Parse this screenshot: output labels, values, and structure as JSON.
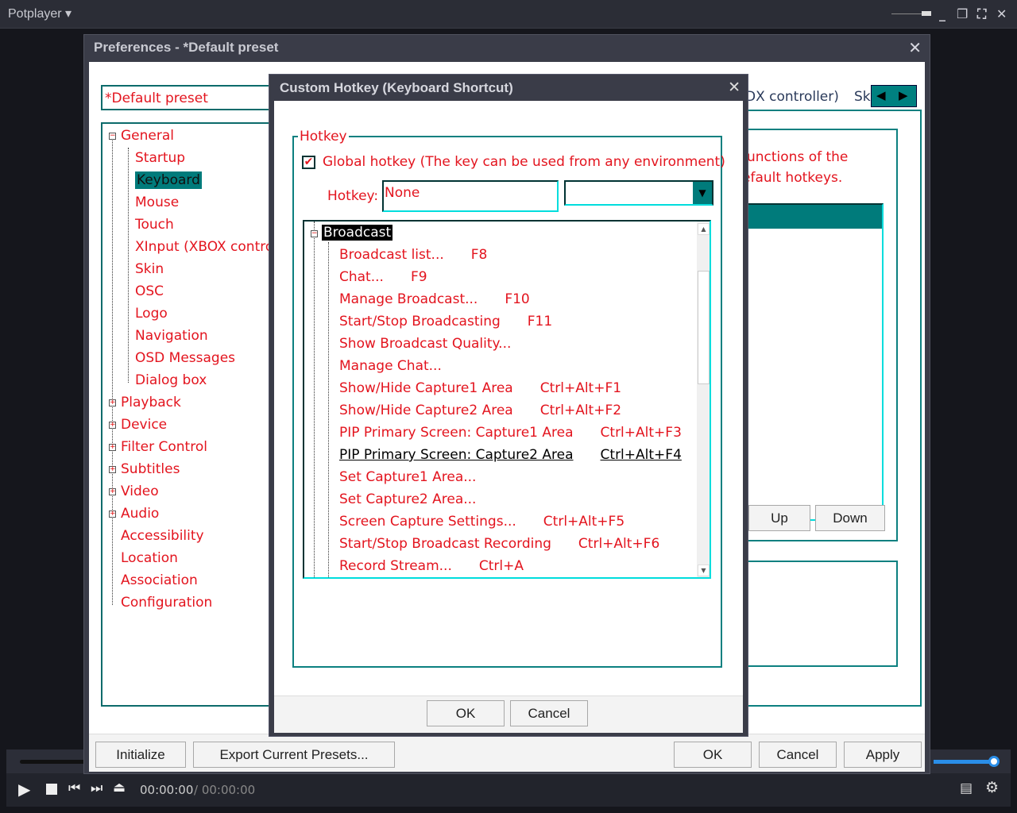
{
  "app": {
    "title": "Potplayer ▾"
  },
  "preferences": {
    "title": "Preferences - *Default preset",
    "preset": "*Default preset",
    "tab_partial": "DX controller)",
    "tab_partial2": "Ski",
    "desc_line1": "functions of the",
    "desc_line2": "efault hotkeys.",
    "up": "Up",
    "down": "Down",
    "tree": [
      {
        "label": "General",
        "level": 0,
        "expander": "−"
      },
      {
        "label": "Startup",
        "level": 1
      },
      {
        "label": "Keyboard",
        "level": 1,
        "selected": true
      },
      {
        "label": "Mouse",
        "level": 1
      },
      {
        "label": "Touch",
        "level": 1
      },
      {
        "label": "XInput (XBOX contro",
        "level": 1
      },
      {
        "label": "Skin",
        "level": 1
      },
      {
        "label": "OSC",
        "level": 1
      },
      {
        "label": "Logo",
        "level": 1
      },
      {
        "label": "Navigation",
        "level": 1
      },
      {
        "label": "OSD Messages",
        "level": 1
      },
      {
        "label": "Dialog box",
        "level": 1
      },
      {
        "label": "Playback",
        "level": 0,
        "expander": "+"
      },
      {
        "label": "Device",
        "level": 0,
        "expander": "+"
      },
      {
        "label": "Filter Control",
        "level": 0,
        "expander": "+"
      },
      {
        "label": "Subtitles",
        "level": 0,
        "expander": "+"
      },
      {
        "label": "Video",
        "level": 0,
        "expander": "+"
      },
      {
        "label": "Audio",
        "level": 0,
        "expander": "+"
      },
      {
        "label": "Accessibility",
        "level": 0
      },
      {
        "label": "Location",
        "level": 0
      },
      {
        "label": "Association",
        "level": 0
      },
      {
        "label": "Configuration",
        "level": 0
      }
    ],
    "buttons": {
      "initialize": "Initialize",
      "export": "Export Current Presets...",
      "ok": "OK",
      "cancel": "Cancel",
      "apply": "Apply"
    }
  },
  "hotkey_dialog": {
    "title": "Custom Hotkey (Keyboard Shortcut)",
    "group": "Hotkey",
    "global_label": "Global hotkey (The key can be used from any environment)",
    "global_checked": true,
    "hotkey_label": "Hotkey:",
    "hotkey_value": "None",
    "dropdown_value": "",
    "root": "Broadcast",
    "items": [
      {
        "label": "Broadcast list...",
        "key": "F8"
      },
      {
        "label": "Chat...",
        "key": "F9"
      },
      {
        "label": "Manage Broadcast...",
        "key": "F10"
      },
      {
        "label": "Start/Stop Broadcasting",
        "key": "F11"
      },
      {
        "label": "Show Broadcast Quality...",
        "key": ""
      },
      {
        "label": "Manage Chat...",
        "key": ""
      },
      {
        "label": "Show/Hide Capture1 Area",
        "key": "Ctrl+Alt+F1"
      },
      {
        "label": "Show/Hide Capture2 Area",
        "key": "Ctrl+Alt+F2"
      },
      {
        "label": "PIP Primary Screen:  Capture1 Area",
        "key": "Ctrl+Alt+F3"
      },
      {
        "label": "PIP Primary Screen:  Capture2 Area",
        "key": "Ctrl+Alt+F4",
        "hover": true
      },
      {
        "label": "Set Capture1 Area...",
        "key": ""
      },
      {
        "label": "Set Capture2 Area...",
        "key": ""
      },
      {
        "label": "Screen Capture Settings...",
        "key": "Ctrl+Alt+F5"
      },
      {
        "label": "Start/Stop Broadcast Recording",
        "key": "Ctrl+Alt+F6"
      },
      {
        "label": "Record Stream...",
        "key": "Ctrl+A"
      }
    ],
    "ok": "OK",
    "cancel": "Cancel"
  },
  "player": {
    "time_current": "00:00:00",
    "time_total": "/ 00:00:00",
    "volume": 1.0
  }
}
